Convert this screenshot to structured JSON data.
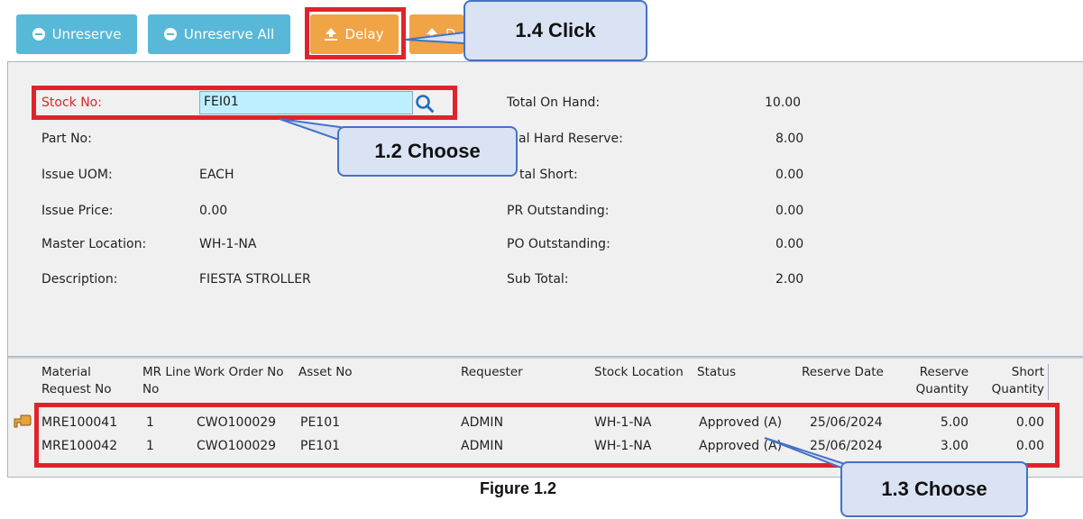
{
  "toolbar": {
    "unreserve": "Unreserve",
    "unreserve_all": "Unreserve All",
    "delay": "Delay",
    "partial": "D"
  },
  "form": {
    "stock_no_label": "Stock No:",
    "stock_no_value": "FEI01",
    "part_no_label": "Part No:",
    "issue_uom_label": "Issue UOM:",
    "issue_uom_value": "EACH",
    "issue_price_label": "Issue Price:",
    "issue_price_value": "0.00",
    "master_location_label": "Master Location:",
    "master_location_value": "WH-1-NA",
    "description_label": "Description:",
    "description_value": "FIESTA STROLLER",
    "total_on_hand_label": "Total On Hand:",
    "total_on_hand_value": "10.00",
    "total_hard_reserve_label": "al Hard Reserve:",
    "total_hard_reserve_value": "8.00",
    "total_short_label": "tal Short:",
    "total_short_value": "0.00",
    "pr_outstanding_label": "PR Outstanding:",
    "pr_outstanding_value": "0.00",
    "po_outstanding_label": "PO Outstanding:",
    "po_outstanding_value": "0.00",
    "sub_total_label": "Sub Total:",
    "sub_total_value": "2.00"
  },
  "table": {
    "headers": {
      "material_request_1": "Material",
      "material_request_2": "Request No",
      "mr_line_1": "MR Line",
      "mr_line_2": "No",
      "work_order": "Work Order No",
      "asset_no": "Asset No",
      "requester": "Requester",
      "stock_location": "Stock Location",
      "status": "Status",
      "reserve_date": "Reserve Date",
      "reserve_qty_1": "Reserve",
      "reserve_qty_2": "Quantity",
      "short_qty_1": "Short",
      "short_qty_2": "Quantity"
    },
    "rows": [
      {
        "mr_no": "MRE100041",
        "line": "1",
        "work_order": "CWO100029",
        "asset": "PE101",
        "requester": "ADMIN",
        "location": "WH-1-NA",
        "status": "Approved (A)",
        "date": "25/06/2024",
        "reserve": "5.00",
        "short": "0.00"
      },
      {
        "mr_no": "MRE100042",
        "line": "1",
        "work_order": "CWO100029",
        "asset": "PE101",
        "requester": "ADMIN",
        "location": "WH-1-NA",
        "status": "Approved (A)",
        "date": "25/06/2024",
        "reserve": "3.00",
        "short": "0.00"
      }
    ]
  },
  "callouts": {
    "click": "1.4 Click",
    "choose_stock": "1.2 Choose",
    "choose_rows": "1.3 Choose"
  },
  "caption": "Figure 1.2"
}
